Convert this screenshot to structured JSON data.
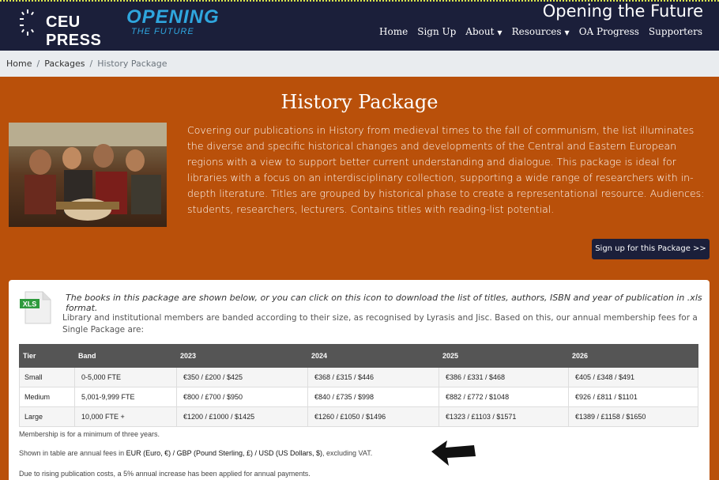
{
  "header": {
    "logo_text": "CEU PRESS",
    "otf_line1": "OPENING",
    "otf_line2": "THE FUTURE",
    "site_title": "Opening the Future",
    "nav": [
      {
        "label": "Home",
        "dropdown": false
      },
      {
        "label": "Sign Up",
        "dropdown": false
      },
      {
        "label": "About",
        "dropdown": true
      },
      {
        "label": "Resources",
        "dropdown": true
      },
      {
        "label": "OA Progress",
        "dropdown": false
      },
      {
        "label": "Supporters",
        "dropdown": false
      }
    ]
  },
  "breadcrumb": {
    "home": "Home",
    "packages": "Packages",
    "current": "History Package"
  },
  "hero": {
    "title": "History Package",
    "description": "Covering our publications in History from medieval times to the fall of communism, the list illuminates the diverse and specific historical changes and developments of the Central and Eastern European regions with a view to support better current understanding and dialogue. This package is ideal for libraries with a focus on an interdisciplinary collection, supporting a wide range of researchers with in-depth literature. Titles are grouped by historical phase to create a representational resource. Audiences: students, researchers, lecturers. Contains titles with reading-list potential.",
    "signup_button": "Sign up for this Package >>"
  },
  "card": {
    "xls_label": "XLS",
    "xls_text": "The books in this package are shown below, or you can click on this icon to download the list of titles, authors, ISBN and year of publication in .xls format.",
    "band_note": "Library and institutional members are banded according to their size, as recognised by Lyrasis and Jisc. Based on this, our annual membership fees for a Single Package are:",
    "table": {
      "headers": [
        "Tier",
        "Band",
        "2023",
        "2024",
        "2025",
        "2026"
      ],
      "rows": [
        [
          "Small",
          "0-5,000 FTE",
          "€350 / £200 / $425",
          "€368 / £315 / $446",
          "€386 / £331 / $468",
          "€405 / £348 / $491"
        ],
        [
          "Medium",
          "5,001-9,999 FTE",
          "€800 / £700 / $950",
          "€840 / £735 / $998",
          "€882 / £772 / $1048",
          "€926 / £811 / $1101"
        ],
        [
          "Large",
          "10,000 FTE +",
          "€1200 / £1000 / $1425",
          "€1260 / £1050 / $1496",
          "€1323 / £1103 / $1571",
          "€1389 / £1158 / $1650"
        ]
      ]
    },
    "note_minimum": "Membership is for a minimum of three years.",
    "note_fees_pre": "Shown in table are annual fees in ",
    "note_fees_bold": "EUR (Euro, €) / GBP (Pound Sterling, £) / USD (US Dollars, $)",
    "note_fees_post": ", excluding VAT.",
    "note_increase": "Due to rising publication costs, a 5% annual increase has been applied for annual payments."
  },
  "colors": {
    "header_bg": "#1b1f3a",
    "hero_bg": "#b9500a",
    "accent_blue": "#2fa6de",
    "table_header_bg": "#555555"
  }
}
